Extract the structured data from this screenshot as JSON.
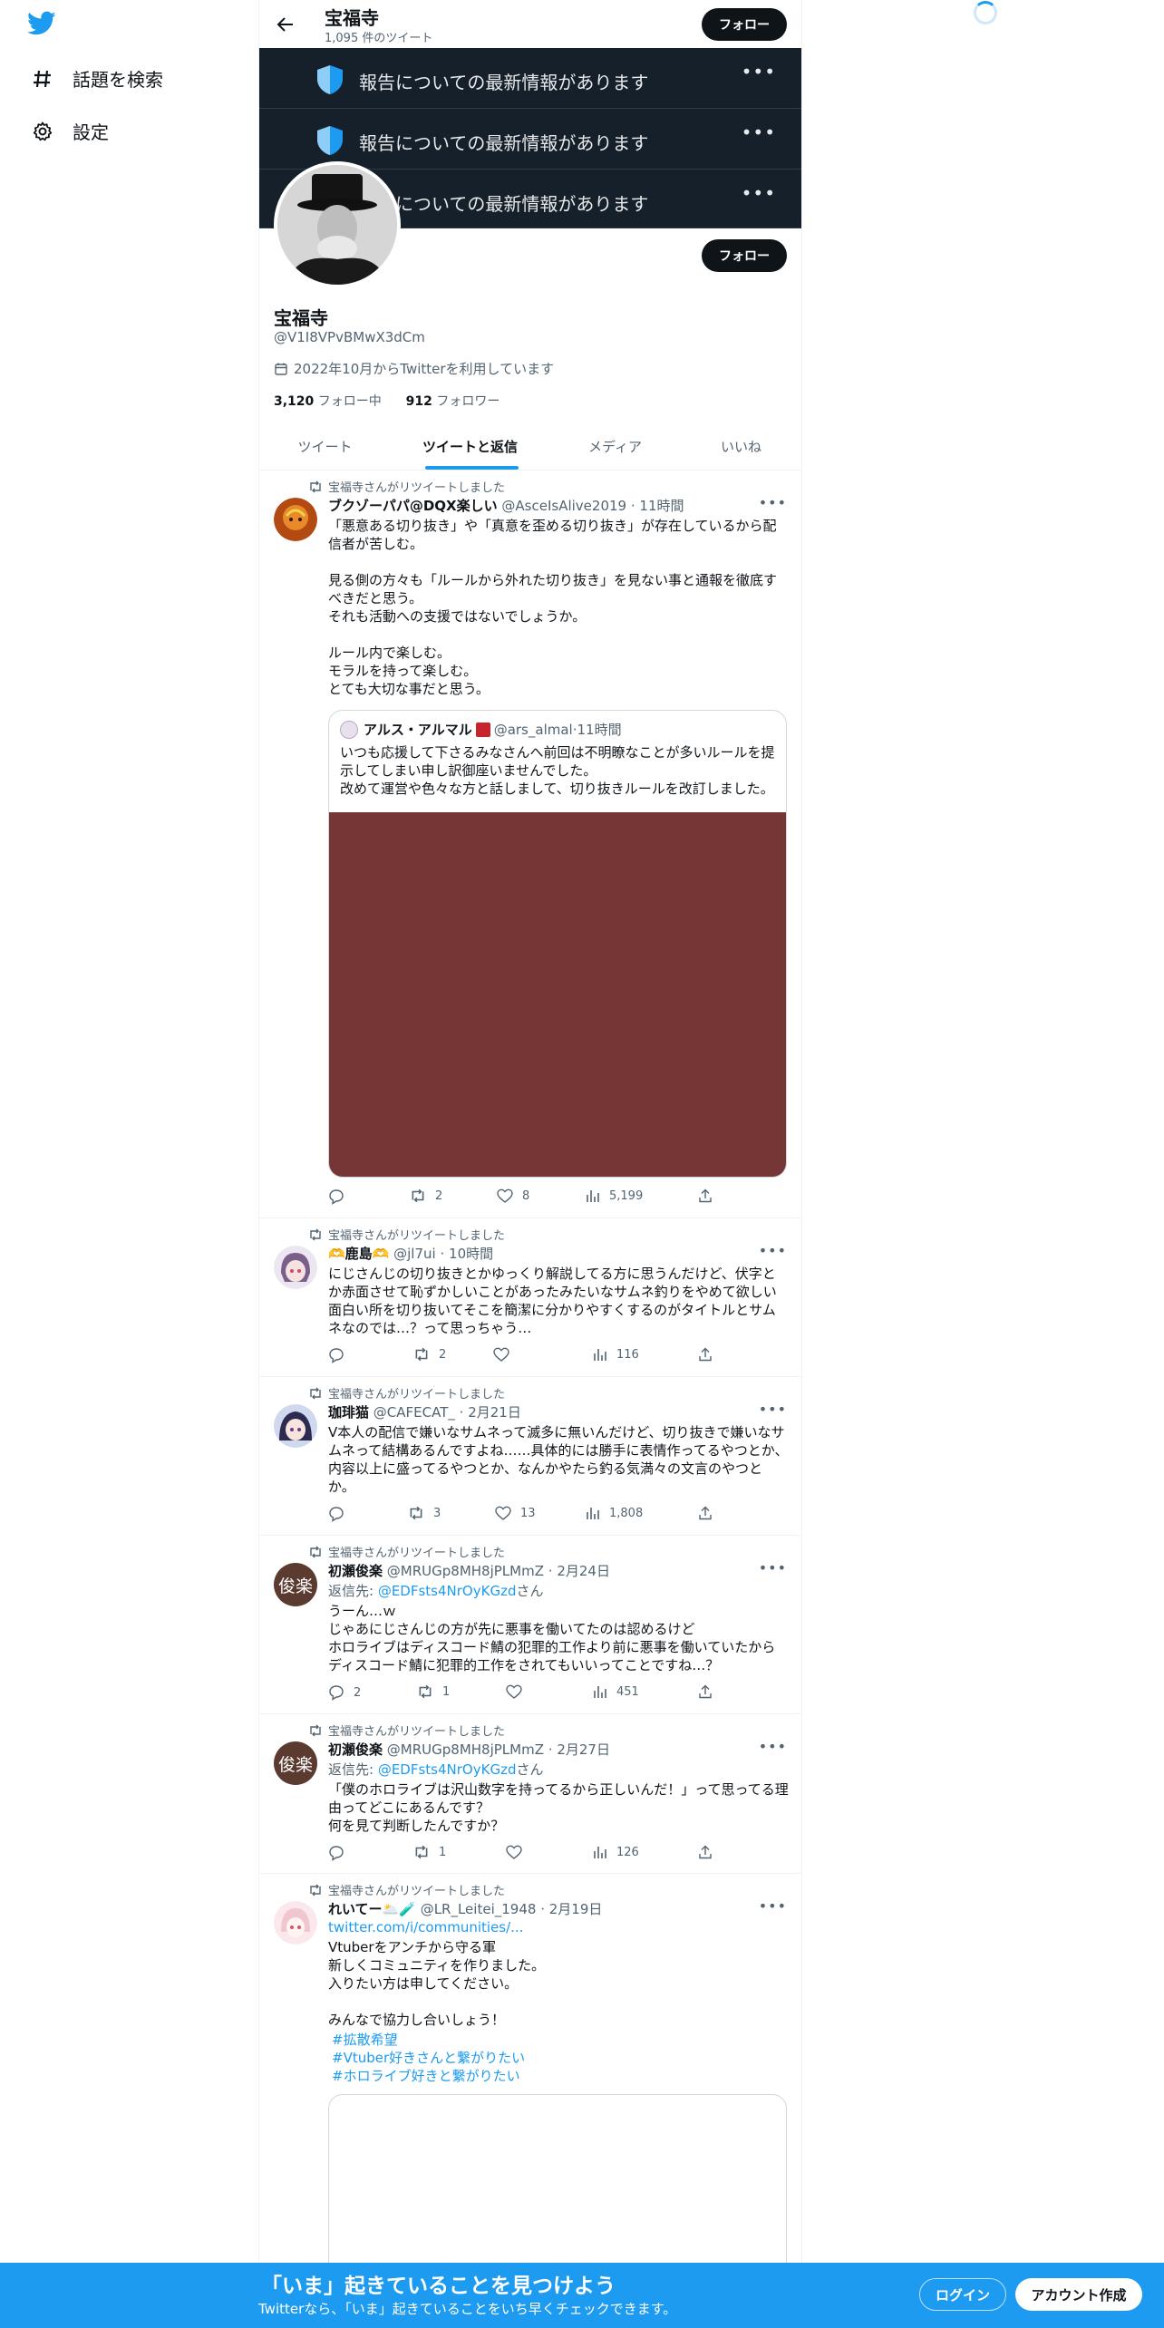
{
  "nav": {
    "items": [
      {
        "label": "話題を検索",
        "icon": "hashtag-icon"
      },
      {
        "label": "設定",
        "icon": "gear-icon"
      }
    ]
  },
  "header": {
    "title": "宝福寺",
    "subtitle": "1,095 件のツイート",
    "follow_label": "フォロー"
  },
  "notices": [
    {
      "text": "報告についての最新情報があります"
    },
    {
      "text": "報告についての最新情報があります"
    },
    {
      "text": "報告についての最新情報があります"
    }
  ],
  "profile": {
    "follow_label": "フォロー",
    "name": "宝福寺",
    "handle": "@V1I8VPvBMwX3dCm",
    "joined": "2022年10月からTwitterを利用しています",
    "following_count": "3,120",
    "following_label": "フォロー中",
    "followers_count": "912",
    "followers_label": "フォロワー"
  },
  "tabs": [
    {
      "label": "ツイート",
      "active": false
    },
    {
      "label": "ツイートと返信",
      "active": true
    },
    {
      "label": "メディア",
      "active": false
    },
    {
      "label": "いいね",
      "active": false
    }
  ],
  "retweet_label": "宝福寺さんがリツイートしました",
  "more_label": "•••",
  "tweets": [
    {
      "name": "ブクゾーパパ@DQX楽しい",
      "handle": "@AsceIsAlive2019",
      "time": "11時間",
      "body": "「悪意ある切り抜き」や「真意を歪める切り抜き」が存在しているから配信者が苦しむ。\n\n見る側の方々も「ルールから外れた切り抜き」を見ない事と通報を徹底すべきだと思う。\nそれも活動への支援ではないでしょうか。\n\nルール内で楽しむ。\nモラルを持って楽しむ。\nとても大切な事だと思う。",
      "quote": {
        "name": "アルス・アルマル",
        "handle": "@ars_almal",
        "time": "11時間",
        "body": "いつも応援して下さるみなさんへ前回は不明瞭なことが多いルールを提示してしまい申し訳御座いませんでした。\n改めて運営や色々な方と話しまして、切り抜きルールを改訂しました。"
      },
      "replies": "",
      "retweets": "2",
      "likes": "8",
      "views": "5,199"
    },
    {
      "name": "🫶鹿島🫶",
      "handle": "@jl7ui",
      "time": "10時間",
      "body": "にじさんじの切り抜きとかゆっくり解説してる方に思うんだけど、伏字とか赤面させて恥ずかしいことがあったみたいなサムネ釣りをやめて欲しい面白い所を切り抜いてそこを簡潔に分かりやすくするのがタイトルとサムネなのでは…？って思っちゃう…",
      "replies": "",
      "retweets": "2",
      "likes": "",
      "views": "116"
    },
    {
      "name": "珈琲猫",
      "handle": "@CAFECAT_",
      "time": "2月21日",
      "body": "V本人の配信で嫌いなサムネって滅多に無いんだけど、切り抜きで嫌いなサムネって結構あるんですよね……具体的には勝手に表情作ってるやつとか、内容以上に盛ってるやつとか、なんかやたら釣る気満々の文言のやつとか。",
      "replies": "",
      "retweets": "3",
      "likes": "13",
      "views": "1,808"
    },
    {
      "name": "初瀬俊楽",
      "handle": "@MRUGp8MH8jPLMmZ",
      "time": "2月24日",
      "avatar_text": "俊楽",
      "reply_to_prefix": "返信先: ",
      "reply_to": "@EDFsts4NrOyKGzd",
      "reply_to_suffix": "さん",
      "body": "うーん…ｗ\nじゃあにじさんじの方が先に悪事を働いてたのは認めるけど\nホロライブはディスコード鯖の犯罪的工作より前に悪事を働いていたから\nディスコード鯖に犯罪的工作をされてもいいってことですね…？",
      "replies": "2",
      "retweets": "1",
      "likes": "",
      "views": "451"
    },
    {
      "name": "初瀬俊楽",
      "handle": "@MRUGp8MH8jPLMmZ",
      "time": "2月27日",
      "avatar_text": "俊楽",
      "reply_to_prefix": "返信先: ",
      "reply_to": "@EDFsts4NrOyKGzd",
      "reply_to_suffix": "さん",
      "body": "「僕のホロライブは沢山数字を持ってるから正しいんだ！」って思ってる理由ってどこにあるんです？\n何を見て判断したんですか？",
      "replies": "",
      "retweets": "1",
      "likes": "",
      "views": "126"
    },
    {
      "name": "れいてー🌥️🧪",
      "handle": "@LR_Leitei_1948",
      "time": "2月19日",
      "link": "twitter.com/i/communities/...",
      "body": "Vtuberをアンチから守る軍\n新しくコミュニティを作りました。\n入りたい方は申してください。\n\nみんなで協力し合いしょう！",
      "hashtags": [
        "#拡散希望",
        "#Vtuber好きさんと繋がりたい",
        "#ホロライブ好きと繋がりたい"
      ]
    }
  ],
  "bottom_bar": {
    "title": "「いま」起きていることを見つけよう",
    "subtitle": "Twitterなら、「いま」起きていることをいち早くチェックできます。",
    "login_label": "ログイン",
    "signup_label": "アカウント作成"
  },
  "colors": {
    "accent": "#1d9bf0",
    "notice_bg": "#15202b",
    "media_placeholder": "#773636"
  }
}
